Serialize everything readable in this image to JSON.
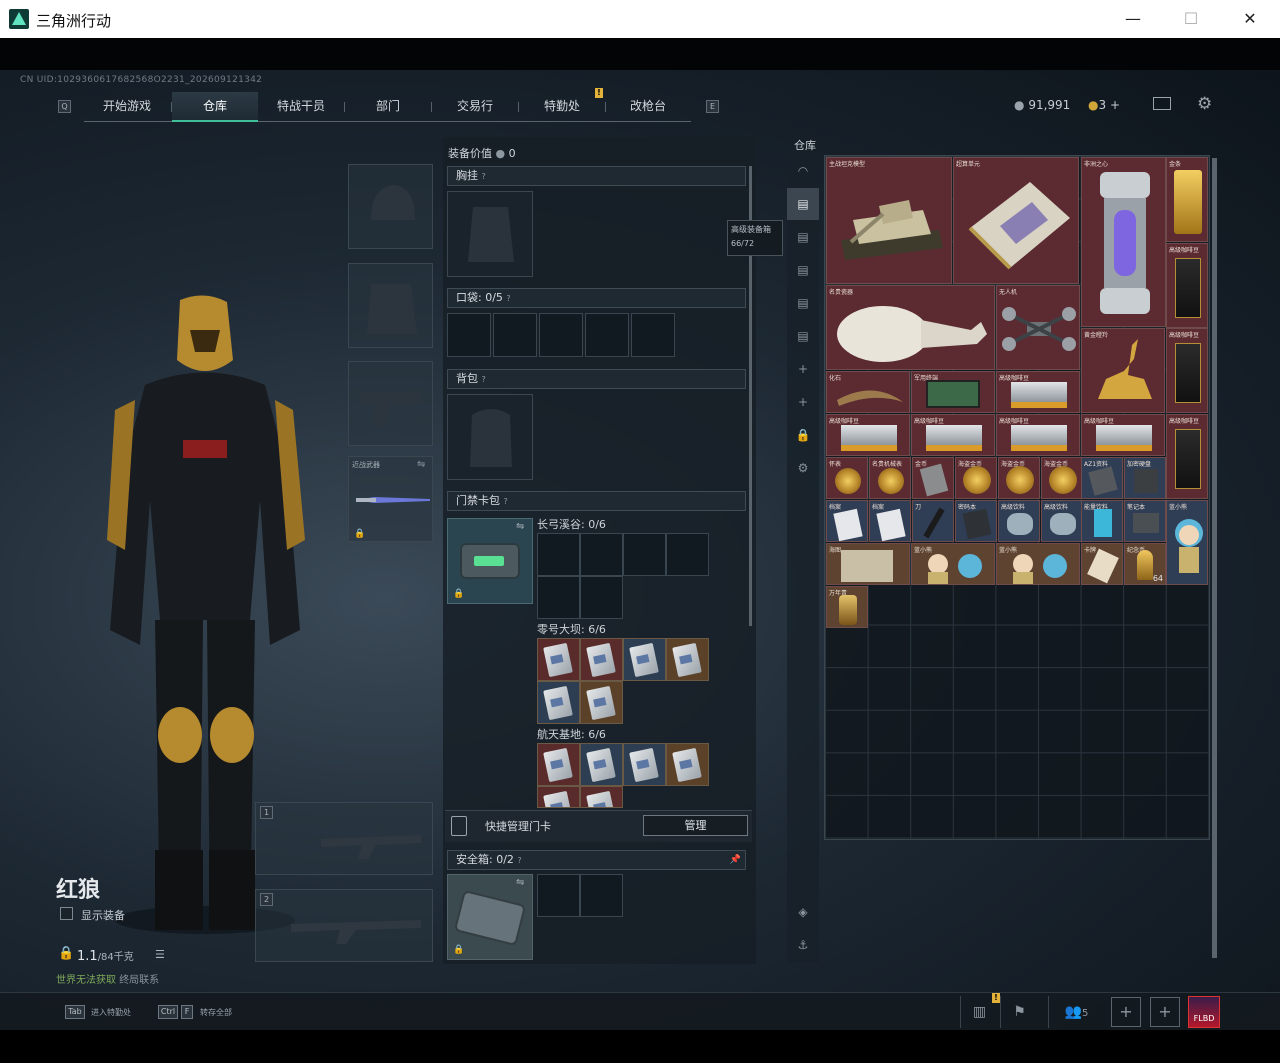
{
  "window": {
    "title": "三角洲行动",
    "minimize": "—",
    "maximize": "☐",
    "close": "✕"
  },
  "uid": "CN UID:1029360617682568O2231_202609121342",
  "nav": {
    "left_key": "Q",
    "right_key": "E",
    "notif": "!",
    "tabs": [
      {
        "label": "开始游戏"
      },
      {
        "label": "仓库"
      },
      {
        "label": "特战干员"
      },
      {
        "label": "部门"
      },
      {
        "label": "交易行"
      },
      {
        "label": "特勤处"
      },
      {
        "label": "改枪台"
      }
    ]
  },
  "currency": {
    "coins": "91,991",
    "tickets": "3",
    "plus": "+"
  },
  "character": {
    "name": "红狼",
    "show_equipment": "显示装备",
    "weight": "1.1",
    "weight_max": "/84千克",
    "world_prefix": "世界",
    "world_status": "无法获取",
    "world_suffix": "终局联系",
    "slot_knife_label": "近战武器",
    "slot1": "1",
    "slot2": "2"
  },
  "equipment": {
    "value_label": "装备价值",
    "value": "0",
    "chest_label": "胸挂",
    "pocket_label": "口袋:",
    "pocket_count": "0/5",
    "backpack_label": "背包",
    "keycard_label": "门禁卡包",
    "maps": [
      {
        "name": "长弓溪谷:",
        "count": "0/6"
      },
      {
        "name": "零号大坝:",
        "count": "6/6"
      },
      {
        "name": "航天基地:",
        "count": "6/6"
      }
    ],
    "quick_manage": "快捷管理门卡",
    "manage_btn": "管理",
    "safe_label": "安全箱:",
    "safe_count": "0/2",
    "qmark": "?"
  },
  "tooltip": {
    "title": "高级装备箱",
    "count": "66/72"
  },
  "warehouse": {
    "label": "仓库",
    "items": [
      {
        "name": "主战坦克模型"
      },
      {
        "name": "超算单元"
      },
      {
        "name": "非洲之心"
      },
      {
        "name": "金条"
      },
      {
        "name": "名贵瓷器"
      },
      {
        "name": "无人机"
      },
      {
        "name": "黄金瞪羚"
      },
      {
        "name": "高级咖啡豆"
      },
      {
        "name": "化石"
      },
      {
        "name": "军用终端"
      },
      {
        "name": "高级咖啡豆"
      },
      {
        "name": "高级咖啡豆"
      },
      {
        "name": "高级咖啡豆"
      },
      {
        "name": "高级咖啡豆"
      },
      {
        "name": "高级咖啡豆"
      },
      {
        "name": "高级咖啡豆"
      },
      {
        "name": "怀表"
      },
      {
        "name": "名贵机械表"
      },
      {
        "name": "金币"
      },
      {
        "name": "海盗金币"
      },
      {
        "name": "海盗金币"
      },
      {
        "name": "海盗金币"
      },
      {
        "name": "AZ1资料"
      },
      {
        "name": "加密硬盘"
      },
      {
        "name": "档案"
      },
      {
        "name": "档案"
      },
      {
        "name": "刀"
      },
      {
        "name": "密码本"
      },
      {
        "name": "高级饮料"
      },
      {
        "name": "高级饮料"
      },
      {
        "name": "能量饮料"
      },
      {
        "name": "笔记本"
      },
      {
        "name": "蓝小熊"
      },
      {
        "name": "海图"
      },
      {
        "name": "蓝小熊"
      },
      {
        "name": "蓝小熊"
      },
      {
        "name": "卡牌"
      },
      {
        "name": "纪念币"
      },
      {
        "name": "万年青"
      }
    ],
    "stack_count": "64"
  },
  "bottom": {
    "tab_key": "Tab",
    "tab_hint": "进入特勤处",
    "ctrl_key": "Ctrl",
    "f_key": "F",
    "ctrl_hint": "转存全部",
    "squad_count": "5",
    "notif": "!",
    "avatar_text": "FLBD"
  }
}
